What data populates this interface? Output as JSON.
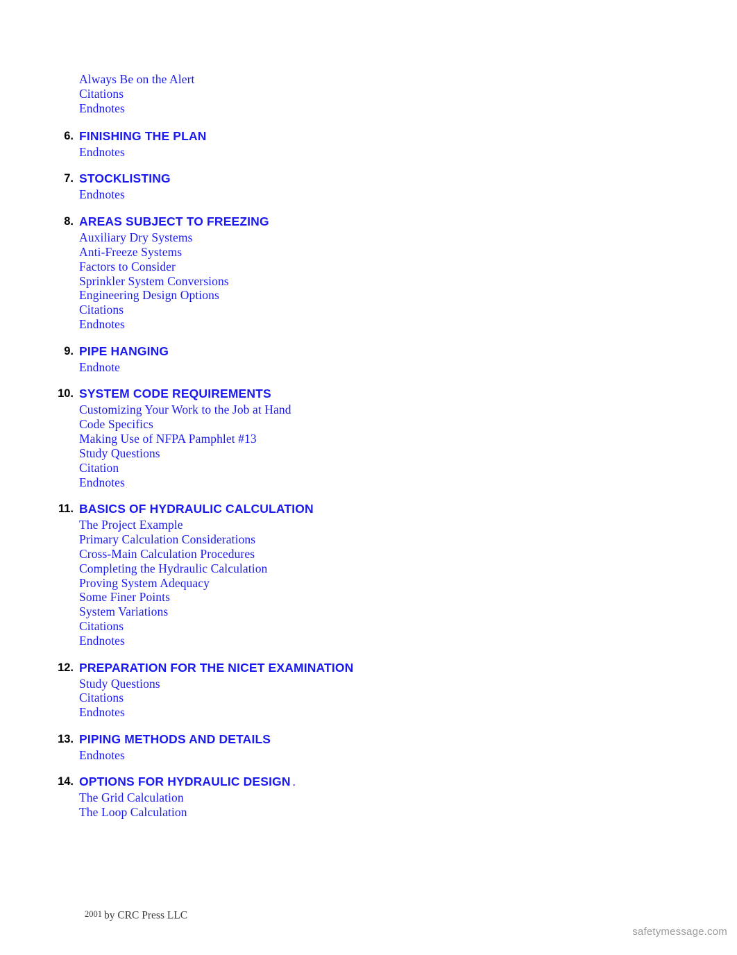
{
  "page": {
    "background_color": "#ffffff",
    "heading_color": "#1a1aee",
    "number_color": "#000000",
    "subitem_color": "#1a1aee",
    "watermark_color": "#9a9a9a"
  },
  "lead_items": [
    "Always Be on the Alert",
    "Citations",
    "Endnotes"
  ],
  "sections": [
    {
      "number": "6.",
      "title": "FINISHING THE PLAN",
      "trailer": "",
      "items": [
        "Endnotes"
      ]
    },
    {
      "number": "7.",
      "title": "STOCKLISTING",
      "trailer": "",
      "items": [
        "Endnotes"
      ]
    },
    {
      "number": "8.",
      "title": "AREAS SUBJECT TO FREEZING",
      "trailer": "",
      "items": [
        "Auxiliary Dry Systems",
        "Anti-Freeze Systems",
        "Factors to Consider",
        "Sprinkler System Conversions",
        "Engineering Design Options",
        "Citations",
        "Endnotes"
      ]
    },
    {
      "number": "9.",
      "title": "PIPE HANGING",
      "trailer": "",
      "items": [
        "Endnote"
      ]
    },
    {
      "number": "10.",
      "title": "SYSTEM CODE REQUIREMENTS",
      "trailer": "",
      "items": [
        "Customizing Your Work to the Job at Hand",
        "Code Specifics",
        "Making Use of NFPA Pamphlet #13",
        "Study Questions",
        "Citation",
        "Endnotes"
      ]
    },
    {
      "number": "11.",
      "title": "BASICS OF HYDRAULIC CALCULATION",
      "trailer": "",
      "items": [
        "The Project Example",
        "Primary Calculation Considerations",
        "Cross-Main Calculation Procedures",
        "Completing the Hydraulic Calculation",
        "Proving System Adequacy",
        "Some Finer Points",
        "System Variations",
        "Citations",
        "Endnotes"
      ]
    },
    {
      "number": "12.",
      "title": "PREPARATION FOR THE NICET EXAMINATION",
      "trailer": "",
      "items": [
        "Study Questions",
        "Citations",
        "Endnotes"
      ]
    },
    {
      "number": "13.",
      "title": "PIPING METHODS AND DETAILS",
      "trailer": "",
      "items": [
        "Endnotes"
      ]
    },
    {
      "number": "14.",
      "title": "OPTIONS FOR HYDRAULIC DESIGN",
      "trailer": ".",
      "items": [
        "The Grid Calculation",
        "The Loop Calculation"
      ]
    }
  ],
  "footer": {
    "year": "2001",
    "text": "by CRC Press LLC"
  },
  "watermark": {
    "text": "safetymessage.com"
  }
}
